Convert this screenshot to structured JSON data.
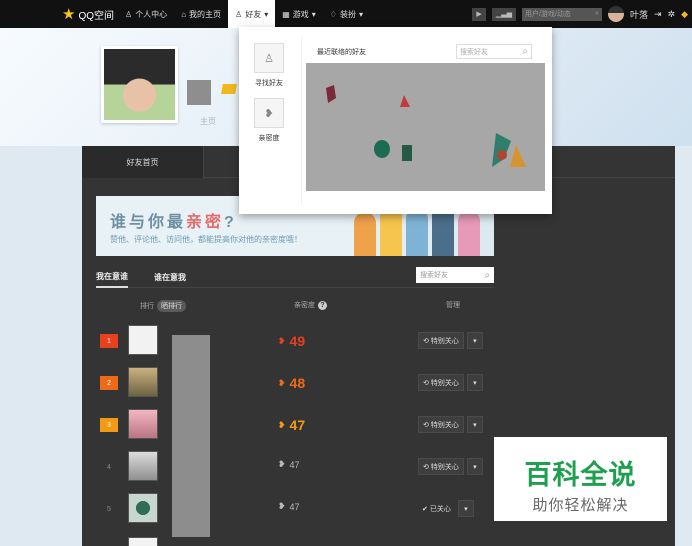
{
  "topbar": {
    "logo": "QQ空间",
    "items": [
      {
        "label": "个人中心",
        "icon": "person-icon"
      },
      {
        "label": "我的主页",
        "icon": "home-icon"
      },
      {
        "label": "好友",
        "icon": "friend-icon"
      },
      {
        "label": "游戏",
        "icon": "grid-icon"
      },
      {
        "label": "装扮",
        "icon": "shirt-icon"
      }
    ],
    "search_placeholder": "用户/游戏/动态",
    "username": "叶落"
  },
  "profile": {
    "nav_main": "主页"
  },
  "dropdown": {
    "find_friends": "寻找好友",
    "intimacy": "亲密度",
    "recent_title": "最近联络的好友",
    "search_placeholder": "搜索好友"
  },
  "panel": {
    "tab_home": "好友首页",
    "banner_title_a": "谁与你最",
    "banner_title_b": "亲密",
    "banner_title_c": "?",
    "banner_sub": "赞他、评论他、访问他，都能提高你对他的亲密度哦！",
    "tab_mine": "我在意谁",
    "tab_theirs": "谁在意我",
    "search_placeholder": "搜索好友",
    "col_rank": "排行",
    "col_rank_pill": "晒排行",
    "col_intimacy": "亲密度",
    "col_manage": "管理"
  },
  "rows": [
    {
      "rank": "1",
      "score": "49",
      "color": "#e8401c",
      "action": "特别关心",
      "crown": true
    },
    {
      "rank": "2",
      "score": "48",
      "color": "#ef6a16",
      "action": "特别关心",
      "crown": true
    },
    {
      "rank": "3",
      "score": "47",
      "color": "#f39a12",
      "action": "特别关心",
      "crown": true
    },
    {
      "rank": "4",
      "score": "47",
      "color": "#bbbbbb",
      "action": "特别关心",
      "crown": false
    },
    {
      "rank": "5",
      "score": "47",
      "color": "#bbbbbb",
      "action": "已关心",
      "crown": false
    }
  ],
  "watermark": {
    "title": "百科全说",
    "sub": "助你轻松解决"
  }
}
